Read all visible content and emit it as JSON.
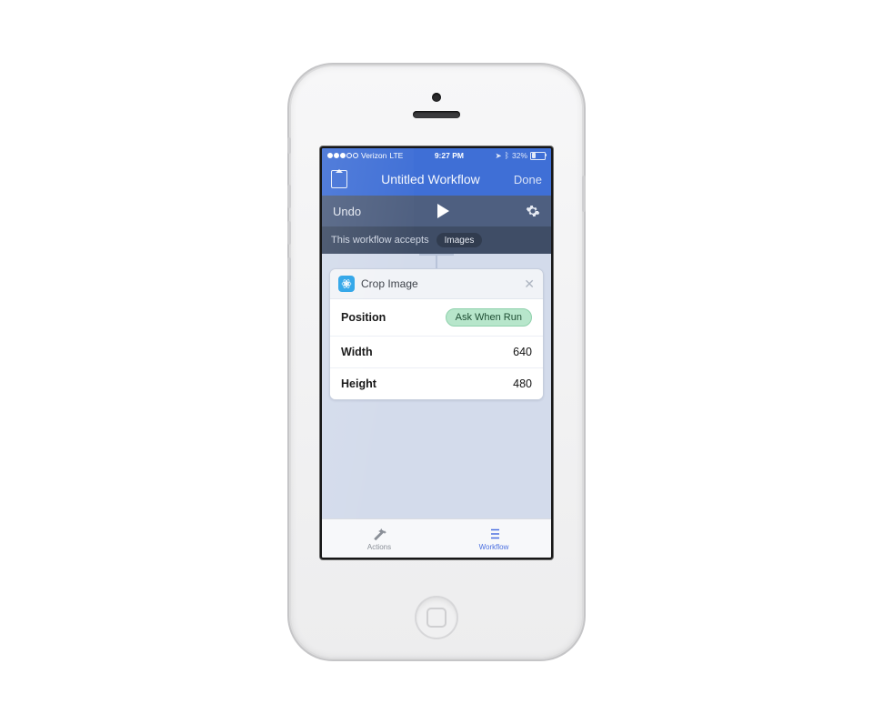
{
  "statusbar": {
    "carrier": "Verizon",
    "network": "LTE",
    "time": "9:27 PM",
    "battery_pct": "32%"
  },
  "navbar": {
    "title": "Untitled Workflow",
    "done_label": "Done"
  },
  "toolbar": {
    "undo_label": "Undo"
  },
  "accepts": {
    "prefix": "This workflow accepts",
    "type": "Images"
  },
  "card": {
    "title": "Crop Image",
    "rows": {
      "position": {
        "label": "Position",
        "value": "Ask When Run"
      },
      "width": {
        "label": "Width",
        "value": "640"
      },
      "height": {
        "label": "Height",
        "value": "480"
      }
    }
  },
  "tabbar": {
    "actions_label": "Actions",
    "workflow_label": "Workflow"
  }
}
